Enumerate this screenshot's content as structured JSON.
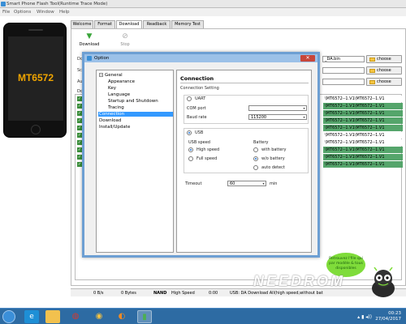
{
  "window": {
    "title": "Smart Phone Flash Tool(Runtime Trace Mode)",
    "menu": [
      "File",
      "Options",
      "Window",
      "Help"
    ]
  },
  "phone": {
    "chip": "MT6572"
  },
  "tabs": [
    "Welcome",
    "Format",
    "Download",
    "Readback",
    "Memory Test"
  ],
  "toolbar": {
    "download": "Download",
    "stop": "Stop"
  },
  "fields": {
    "da_label": "Do",
    "da_path": "_DA.bin",
    "scatter_label": "Sc",
    "auth_label": "Au",
    "choose": "choose"
  },
  "grid": {
    "row_header": "Do",
    "rows": [
      "\\MT6572--1.V1\\MT6572--1.V1",
      "\\MT6572--1.V1\\MT6572--1.V1",
      "\\MT6572--1.V1\\MT6572--1.V1",
      "\\MT6572--1.V1\\MT6572--1.V1",
      "\\MT6572--1.V1\\MT6572--1.V1",
      "\\MT6572--1.V1\\MT6572--1.V1",
      "\\MT6572--1.V1\\MT6572--1.V1",
      "\\MT6572--1.V1\\MT6572--1.V1",
      "\\MT6572--1.V1\\MT6572--1.V1",
      "\\MT6572--1.V1\\MT6572--1.V1"
    ]
  },
  "dialog": {
    "title": "Option",
    "close": "✕",
    "tree": {
      "general": "General",
      "children": [
        "Appearance",
        "Key",
        "Language",
        "Startup and Shutdown",
        "Tracing"
      ],
      "connection": "Connection",
      "download": "Download",
      "install": "Install/Update"
    },
    "content": {
      "heading": "Connection",
      "subheading": "Connection Setting",
      "uart": "UART",
      "com_port": "COM port",
      "baud_rate": "Baud rate",
      "baud_value": "115200",
      "usb": "USB",
      "usb_speed": "USB speed",
      "high_speed": "High speed",
      "full_speed": "Full speed",
      "battery": "Battery",
      "with_battery": "with battery",
      "wo_battery": "w/o battery",
      "auto_detect": "auto detect",
      "timeout": "Timeout",
      "timeout_value": "60",
      "min": "min"
    }
  },
  "status": {
    "rate": "0 B/s",
    "bytes": "0 Bytes",
    "nand": "NAND",
    "speed": "High Speed",
    "time": "0:00",
    "info": "USB: DA Download All(high speed,without bat"
  },
  "overlay": {
    "watermark": "NEEDROM",
    "badge_line1": "Retrouvez l'file qui",
    "badge_line2": "par modèle & tous",
    "badge_line3": "disponibles"
  },
  "clock": {
    "time": "00:23",
    "date": "27/04/2017"
  },
  "colors": {
    "accent": "#3399ff",
    "row_green": "#55a56b",
    "taskbar": "#2d6ba3"
  }
}
